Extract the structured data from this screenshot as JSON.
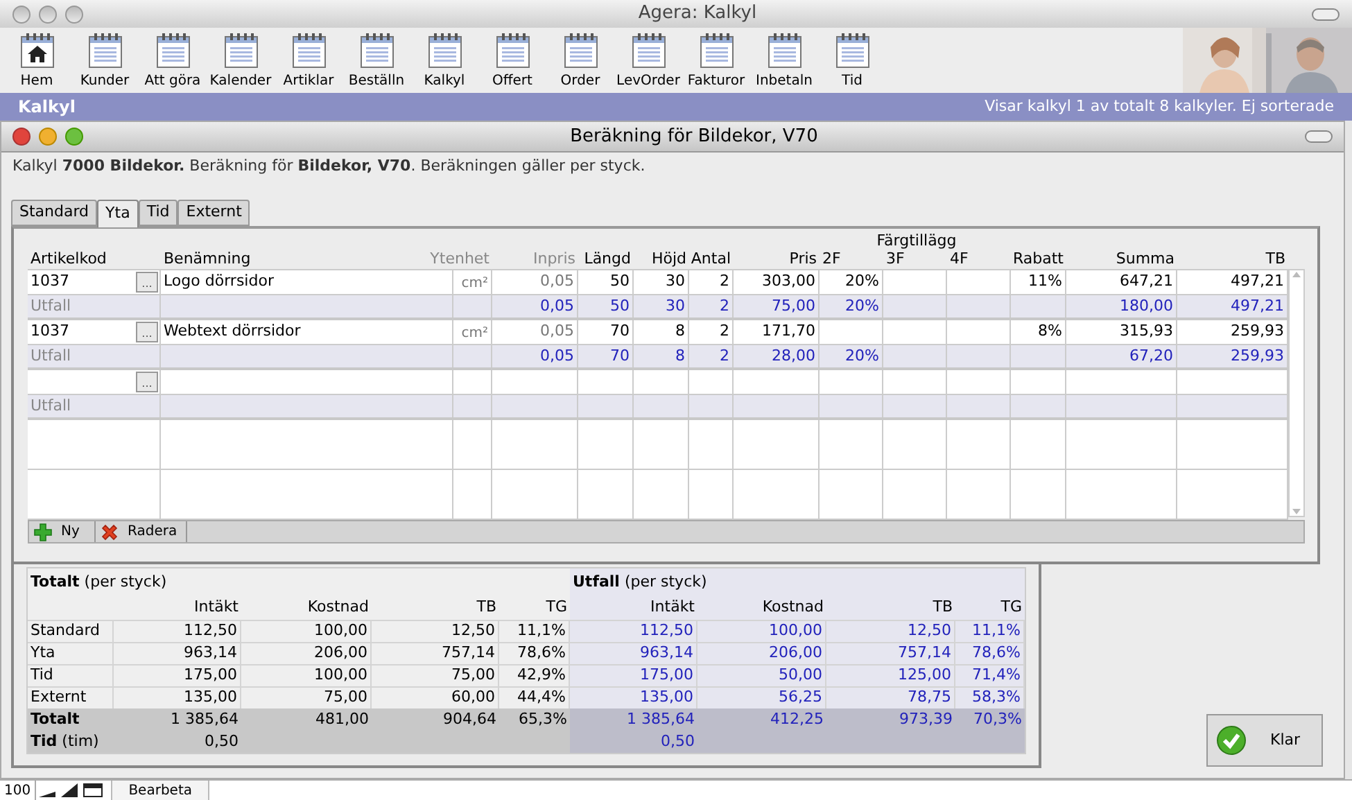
{
  "window": {
    "title": "Agera: Kalkyl"
  },
  "toolbar": [
    {
      "label": "Hem",
      "kind": "home"
    },
    {
      "label": "Kunder",
      "kind": "notepad"
    },
    {
      "label": "Att göra",
      "kind": "notepad"
    },
    {
      "label": "Kalender",
      "kind": "notepad"
    },
    {
      "label": "Artiklar",
      "kind": "notepad"
    },
    {
      "label": "Beställn",
      "kind": "notepad"
    },
    {
      "label": "Kalkyl",
      "kind": "notepad"
    },
    {
      "label": "Offert",
      "kind": "notepad"
    },
    {
      "label": "Order",
      "kind": "notepad"
    },
    {
      "label": "LevOrder",
      "kind": "notepad"
    },
    {
      "label": "Fakturor",
      "kind": "notepad"
    },
    {
      "label": "Inbetaln",
      "kind": "notepad"
    },
    {
      "label": "Tid",
      "kind": "notepad"
    }
  ],
  "section_bar": {
    "title": "Kalkyl",
    "info": "Visar kalkyl 1 av totalt 8 kalkyler. Ej sorterade"
  },
  "dialog": {
    "title": "Beräkning för Bildekor, V70",
    "description": "Kalkyl **7000 Bildekor.** Beräkning för **Bildekor, V70**. Beräkningen gäller per styck."
  },
  "tabs": [
    {
      "label": "Standard",
      "selected": false
    },
    {
      "label": "Yta",
      "selected": true
    },
    {
      "label": "Tid",
      "selected": false
    },
    {
      "label": "Externt",
      "selected": false
    }
  ],
  "table": {
    "group_label": "Färgtillägg",
    "columns": [
      {
        "label": "Artikelkod",
        "muted": false
      },
      {
        "label": "Benämning",
        "muted": false
      },
      {
        "label": "Ytenhet",
        "muted": true
      },
      {
        "label": "Inpris",
        "muted": true
      },
      {
        "label": "Längd",
        "muted": false
      },
      {
        "label": "Höjd",
        "muted": false
      },
      {
        "label": "Antal",
        "muted": false
      },
      {
        "label": "Pris",
        "muted": false
      },
      {
        "label": "2F",
        "muted": false
      },
      {
        "label": "3F",
        "muted": false
      },
      {
        "label": "4F",
        "muted": false
      },
      {
        "label": "Rabatt",
        "muted": false
      },
      {
        "label": "Summa",
        "muted": false
      },
      {
        "label": "TB",
        "muted": false
      }
    ],
    "rows": [
      {
        "kind": "article",
        "browse": "...",
        "cells": [
          "1037",
          "Logo dörrsidor",
          "cm²",
          "0,05",
          "50",
          "30",
          "2",
          "303,00",
          "20%",
          null,
          null,
          "11%",
          "647,21",
          "497,21"
        ]
      },
      {
        "kind": "outcome",
        "cells": [
          "Utfall",
          null,
          null,
          "0,05",
          "50",
          "30",
          "2",
          "75,00",
          "20%",
          null,
          null,
          null,
          "180,00",
          "497,21"
        ]
      },
      {
        "kind": "article",
        "browse": "...",
        "cells": [
          "1037",
          "Webtext dörrsidor",
          "cm²",
          "0,05",
          "70",
          "8",
          "2",
          "171,70",
          null,
          null,
          null,
          "8%",
          "315,93",
          "259,93"
        ]
      },
      {
        "kind": "outcome",
        "cells": [
          "Utfall",
          null,
          null,
          "0,05",
          "70",
          "8",
          "2",
          "28,00",
          "20%",
          null,
          null,
          null,
          "67,20",
          "259,93"
        ]
      },
      {
        "kind": "article",
        "browse": "..."
      },
      {
        "kind": "outcome",
        "cells": [
          "Utfall"
        ]
      }
    ]
  },
  "table_buttons": [
    {
      "label": "Ny",
      "kind": "add"
    },
    {
      "label": "Radera",
      "kind": "delete"
    }
  ],
  "totals": {
    "title": "**Totalt** (per styck)",
    "columns": [
      "Intäkt",
      "Kostnad",
      "TB",
      "TG"
    ],
    "rows": [
      {
        "label": "Standard",
        "kind": "line",
        "values": [
          "112,50",
          "100,00",
          "12,50",
          "11,1%"
        ]
      },
      {
        "label": "Yta",
        "kind": "line",
        "values": [
          "963,14",
          "206,00",
          "757,14",
          "78,6%"
        ]
      },
      {
        "label": "Tid",
        "kind": "line",
        "values": [
          "175,00",
          "100,00",
          "75,00",
          "42,9%"
        ]
      },
      {
        "label": "Externt",
        "kind": "line",
        "values": [
          "135,00",
          "75,00",
          "60,00",
          "44,4%"
        ]
      },
      {
        "label": "Totalt",
        "kind": "total",
        "values": [
          "1 385,64",
          "481,00",
          "904,64",
          "65,3%"
        ]
      },
      {
        "label": "**Tid** (tim)",
        "kind": "hours",
        "values": [
          "0,50"
        ]
      }
    ]
  },
  "outcome": {
    "title": "**Utfall** (per styck)",
    "columns": [
      "Intäkt",
      "Kostnad",
      "TB",
      "TG"
    ],
    "rows": [
      {
        "kind": "line",
        "values": [
          "112,50",
          "100,00",
          "12,50",
          "11,1%"
        ]
      },
      {
        "kind": "line",
        "values": [
          "963,14",
          "206,00",
          "757,14",
          "78,6%"
        ]
      },
      {
        "kind": "line",
        "values": [
          "175,00",
          "50,00",
          "125,00",
          "71,4%"
        ]
      },
      {
        "kind": "line",
        "values": [
          "135,00",
          "56,25",
          "78,75",
          "58,3%"
        ]
      },
      {
        "kind": "total",
        "values": [
          "1 385,64",
          "412,25",
          "973,39",
          "70,3%"
        ]
      },
      {
        "kind": "hours",
        "values": [
          "0,50"
        ]
      }
    ]
  },
  "done_button": {
    "label": "Klar"
  },
  "status_bar": {
    "zoom": "100",
    "mode": "Bearbeta"
  }
}
